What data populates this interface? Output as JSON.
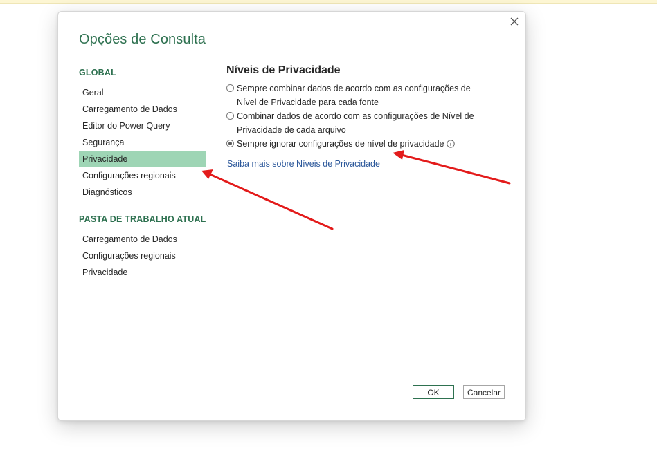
{
  "dialog": {
    "title": "Opções de Consulta",
    "close_icon": "close-icon"
  },
  "sidebar": {
    "global_heading": "GLOBAL",
    "global_items": [
      {
        "label": "Geral",
        "selected": false
      },
      {
        "label": "Carregamento de Dados",
        "selected": false
      },
      {
        "label": "Editor do Power Query",
        "selected": false
      },
      {
        "label": "Segurança",
        "selected": false
      },
      {
        "label": "Privacidade",
        "selected": true
      },
      {
        "label": "Configurações regionais",
        "selected": false
      },
      {
        "label": "Diagnósticos",
        "selected": false
      }
    ],
    "workbook_heading": "PASTA DE TRABALHO ATUAL",
    "workbook_items": [
      {
        "label": "Carregamento de Dados",
        "selected": false
      },
      {
        "label": "Configurações regionais",
        "selected": false
      },
      {
        "label": "Privacidade",
        "selected": false
      }
    ]
  },
  "panel": {
    "title": "Níveis de Privacidade",
    "options": [
      {
        "label": "Sempre combinar dados de acordo com as configurações de Nível de Privacidade para cada fonte",
        "checked": false
      },
      {
        "label": "Combinar dados de acordo com as configurações de Nível de Privacidade de cada arquivo",
        "checked": false
      },
      {
        "label": "Sempre ignorar configurações de nível de privacidade",
        "checked": true,
        "info_icon": "info-icon"
      }
    ],
    "learn_more_link": "Saiba mais sobre Níveis de Privacidade"
  },
  "buttons": {
    "ok": "OK",
    "cancel": "Cancelar"
  },
  "colors": {
    "accent_green": "#2e7150",
    "selected_bg": "#9ed5b5",
    "link_blue": "#2b579a",
    "annotation_red": "#e31b1b"
  }
}
